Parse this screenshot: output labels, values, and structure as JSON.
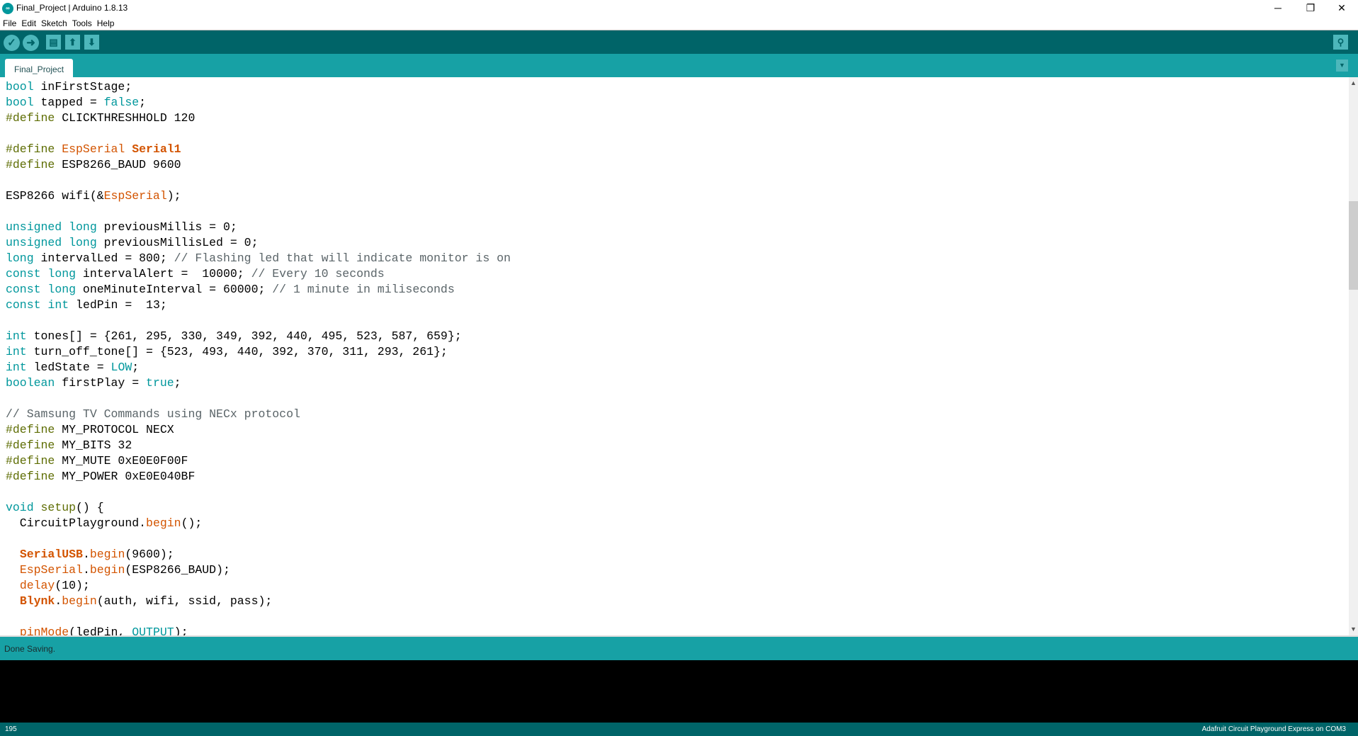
{
  "window": {
    "title": "Final_Project | Arduino 1.8.13",
    "minimize": "─",
    "maximize": "❐",
    "close": "✕"
  },
  "menu": [
    "File",
    "Edit",
    "Sketch",
    "Tools",
    "Help"
  ],
  "toolbar": {
    "verify": "✓",
    "upload": "➜",
    "new": "▤",
    "open": "⬆",
    "save": "⬇",
    "serial_monitor": "⚲"
  },
  "tabs": [
    {
      "label": "Final_Project",
      "active": true
    }
  ],
  "tab_menu": "▼",
  "colors": {
    "toolbar": "#006468",
    "tabs": "#17a1a5",
    "keyword": "#00979c",
    "preprocessor": "#5e6d03",
    "function": "#d35400"
  },
  "code_lines": [
    [
      [
        "k",
        "bool"
      ],
      [
        "p",
        " inFirstStage;"
      ]
    ],
    [
      [
        "k",
        "bool"
      ],
      [
        "p",
        " tapped = "
      ],
      [
        "k",
        "false"
      ],
      [
        "p",
        ";"
      ]
    ],
    [
      [
        "d",
        "#define"
      ],
      [
        "p",
        " CLICKTHRESHHOLD 120"
      ]
    ],
    [],
    [
      [
        "d",
        "#define"
      ],
      [
        "p",
        " "
      ],
      [
        "f",
        "EspSerial"
      ],
      [
        "p",
        " "
      ],
      [
        "b",
        "Serial1"
      ]
    ],
    [
      [
        "d",
        "#define"
      ],
      [
        "p",
        " ESP8266_BAUD 9600"
      ]
    ],
    [],
    [
      [
        "p",
        "ESP8266 wifi(&"
      ],
      [
        "f",
        "EspSerial"
      ],
      [
        "p",
        ");"
      ]
    ],
    [],
    [
      [
        "k",
        "unsigned"
      ],
      [
        "p",
        " "
      ],
      [
        "k",
        "long"
      ],
      [
        "p",
        " previousMillis = 0;"
      ]
    ],
    [
      [
        "k",
        "unsigned"
      ],
      [
        "p",
        " "
      ],
      [
        "k",
        "long"
      ],
      [
        "p",
        " previousMillisLed = 0;"
      ]
    ],
    [
      [
        "k",
        "long"
      ],
      [
        "p",
        " intervalLed = 800; "
      ],
      [
        "c",
        "// Flashing led that will indicate monitor is on"
      ]
    ],
    [
      [
        "k",
        "const"
      ],
      [
        "p",
        " "
      ],
      [
        "k",
        "long"
      ],
      [
        "p",
        " intervalAlert =  10000; "
      ],
      [
        "c",
        "// Every 10 seconds"
      ]
    ],
    [
      [
        "k",
        "const"
      ],
      [
        "p",
        " "
      ],
      [
        "k",
        "long"
      ],
      [
        "p",
        " oneMinuteInterval = 60000; "
      ],
      [
        "c",
        "// 1 minute in miliseconds"
      ]
    ],
    [
      [
        "k",
        "const"
      ],
      [
        "p",
        " "
      ],
      [
        "k",
        "int"
      ],
      [
        "p",
        " ledPin =  13;"
      ]
    ],
    [],
    [
      [
        "k",
        "int"
      ],
      [
        "p",
        " tones[] = {261, 295, 330, 349, 392, 440, 495, 523, 587, 659};"
      ]
    ],
    [
      [
        "k",
        "int"
      ],
      [
        "p",
        " turn_off_tone[] = {523, 493, 440, 392, 370, 311, 293, 261};"
      ]
    ],
    [
      [
        "k",
        "int"
      ],
      [
        "p",
        " ledState = "
      ],
      [
        "k",
        "LOW"
      ],
      [
        "p",
        ";"
      ]
    ],
    [
      [
        "k",
        "boolean"
      ],
      [
        "p",
        " firstPlay = "
      ],
      [
        "k",
        "true"
      ],
      [
        "p",
        ";"
      ]
    ],
    [],
    [
      [
        "c",
        "// Samsung TV Commands using NECx protocol"
      ]
    ],
    [
      [
        "d",
        "#define"
      ],
      [
        "p",
        " MY_PROTOCOL NECX"
      ]
    ],
    [
      [
        "d",
        "#define"
      ],
      [
        "p",
        " MY_BITS 32"
      ]
    ],
    [
      [
        "d",
        "#define"
      ],
      [
        "p",
        " MY_MUTE 0xE0E0F00F"
      ]
    ],
    [
      [
        "d",
        "#define"
      ],
      [
        "p",
        " MY_POWER 0xE0E040BF"
      ]
    ],
    [],
    [
      [
        "k",
        "void"
      ],
      [
        "p",
        " "
      ],
      [
        "d",
        "setup"
      ],
      [
        "p",
        "() {"
      ]
    ],
    [
      [
        "p",
        "  CircuitPlayground."
      ],
      [
        "f",
        "begin"
      ],
      [
        "p",
        "();"
      ]
    ],
    [],
    [
      [
        "p",
        "  "
      ],
      [
        "b",
        "SerialUSB"
      ],
      [
        "p",
        "."
      ],
      [
        "f",
        "begin"
      ],
      [
        "p",
        "(9600);"
      ]
    ],
    [
      [
        "p",
        "  "
      ],
      [
        "f",
        "EspSerial"
      ],
      [
        "p",
        "."
      ],
      [
        "f",
        "begin"
      ],
      [
        "p",
        "(ESP8266_BAUD);"
      ]
    ],
    [
      [
        "p",
        "  "
      ],
      [
        "f",
        "delay"
      ],
      [
        "p",
        "(10);"
      ]
    ],
    [
      [
        "p",
        "  "
      ],
      [
        "b",
        "Blynk"
      ],
      [
        "p",
        "."
      ],
      [
        "f",
        "begin"
      ],
      [
        "p",
        "(auth, wifi, ssid, pass);"
      ]
    ],
    [],
    [
      [
        "p",
        "  "
      ],
      [
        "f",
        "pinMode"
      ],
      [
        "p",
        "(ledPin, "
      ],
      [
        "k",
        "OUTPUT"
      ],
      [
        "p",
        ");"
      ]
    ]
  ],
  "scroll": {
    "up": "▲",
    "down": "▼"
  },
  "status": {
    "message": "Done Saving."
  },
  "footer": {
    "line_number": "195",
    "board": "Adafruit Circuit Playground Express on COM3"
  }
}
